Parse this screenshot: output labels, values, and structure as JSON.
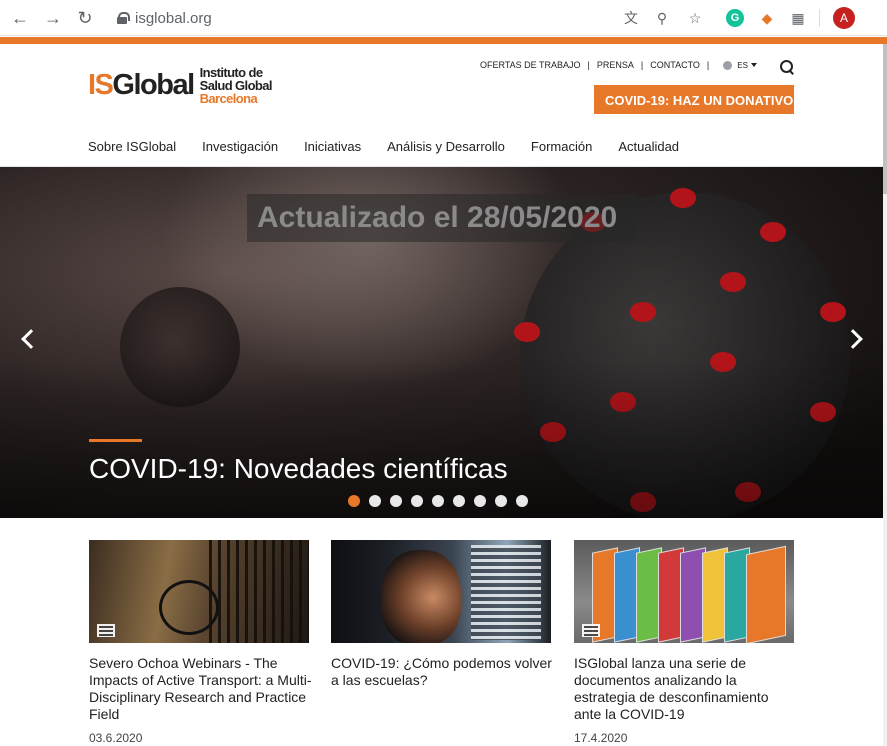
{
  "browser": {
    "url": "isglobal.org",
    "profile_initial": "A",
    "icons": [
      "back-icon",
      "forward-icon",
      "reload-icon",
      "lock-icon",
      "translate-icon",
      "zoom-icon",
      "star-icon",
      "grammarly-icon",
      "extension-icon",
      "apps-icon"
    ]
  },
  "colors": {
    "accent": "#e7782a",
    "text": "#222222",
    "avatar": "#c5221f"
  },
  "header": {
    "logo": {
      "is": "IS",
      "global": "Global",
      "line1": "Instituto de",
      "line2": "Salud Global",
      "city": "Barcelona"
    },
    "toplinks": [
      "OFERTAS DE TRABAJO",
      "PRENSA",
      "CONTACTO"
    ],
    "divider": "|",
    "language": "ES",
    "donate_button": "COVID-19: HAZ UN DONATIVO"
  },
  "nav": {
    "items": [
      "Sobre ISGlobal",
      "Investigación",
      "Iniciativas",
      "Análisis y Desarrollo",
      "Formación",
      "Actualidad"
    ]
  },
  "hero": {
    "updated": "Actualizado el 28/05/2020",
    "title": "COVID-19: Novedades científicas",
    "slides_total": 9,
    "active_slide": 1
  },
  "cards": [
    {
      "title": "Severo Ochoa Webinars - The Impacts of Active Transport: a Multi-Disciplinary Research and Practice Field",
      "date": "03.6.2020",
      "icon": "news-icon"
    },
    {
      "title": "COVID-19: ¿Cómo podemos volver a las escuelas?",
      "date": ""
    },
    {
      "title": "ISGlobal lanza una serie de documentos analizando la estrategia de desconfinamiento ante la COVID-19",
      "date": "17.4.2020",
      "icon": "news-icon"
    }
  ]
}
